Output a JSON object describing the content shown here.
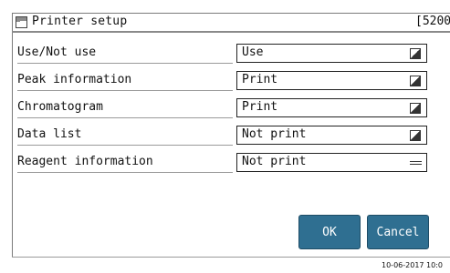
{
  "window": {
    "title": "Printer setup",
    "screen_id": "[5200"
  },
  "rows": [
    {
      "label": "Use/Not use",
      "value": "Use",
      "icon": "dropdown-icon"
    },
    {
      "label": "Peak information",
      "value": "Print",
      "icon": "dropdown-icon"
    },
    {
      "label": "Chromatogram",
      "value": "Print",
      "icon": "dropdown-icon"
    },
    {
      "label": "Data list",
      "value": "Not print",
      "icon": "dropdown-icon"
    },
    {
      "label": "Reagent information",
      "value": "Not print",
      "icon": "list-icon"
    }
  ],
  "buttons": {
    "ok": "OK",
    "cancel": "Cancel"
  },
  "footer": {
    "timestamp": "10-06-2017 10:0"
  },
  "colors": {
    "button_bg": "#2f6f91",
    "button_text": "#ffffff"
  }
}
